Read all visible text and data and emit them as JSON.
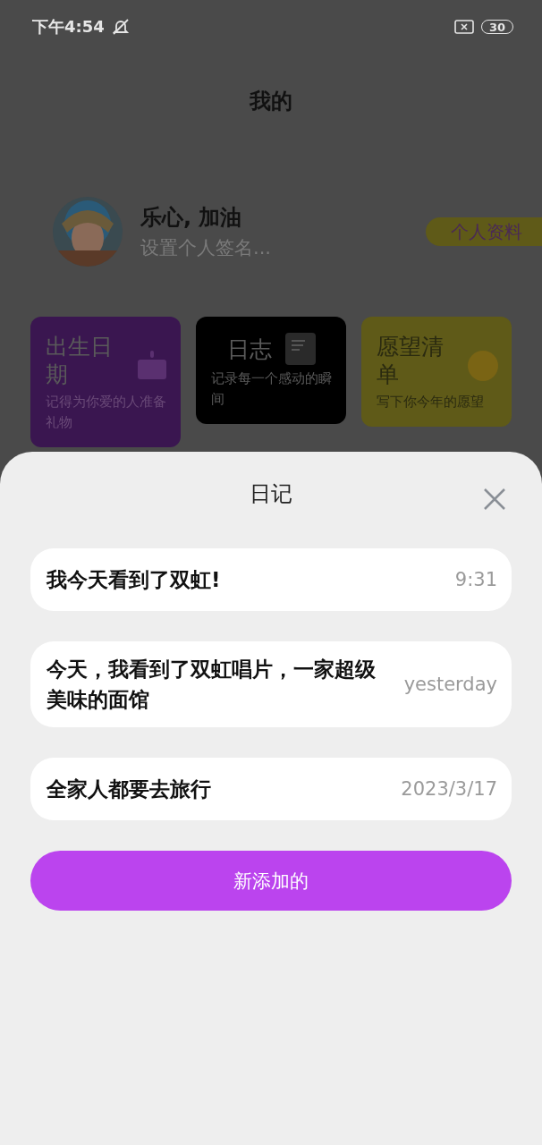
{
  "status_bar": {
    "time": "下午4:54",
    "battery": "30"
  },
  "header": {
    "title": "我的"
  },
  "profile": {
    "name": "乐心, 加油",
    "signature": "设置个人签名...",
    "button": "个人资料"
  },
  "cards": [
    {
      "kind": "cake",
      "title": "出生日期",
      "subtitle": "记得为你爱的人准备礼物",
      "color": "#3a1650"
    },
    {
      "kind": "note",
      "title": "日志",
      "subtitle": "记录每一个感动的瞬间",
      "color": "#000000"
    },
    {
      "kind": "coin",
      "title": "愿望清单",
      "subtitle": "写下你今年的愿望",
      "color": "#5f5a18"
    }
  ],
  "sheet": {
    "title": "日记",
    "entries": [
      {
        "text": "我今天看到了双虹!",
        "time": "9:31"
      },
      {
        "text": "今天，我看到了双虹唱片，一家超级美味的面馆",
        "time": "yesterday"
      },
      {
        "text": "全家人都要去旅行",
        "time": "2023/3/17"
      }
    ],
    "add_button": "新添加的"
  }
}
